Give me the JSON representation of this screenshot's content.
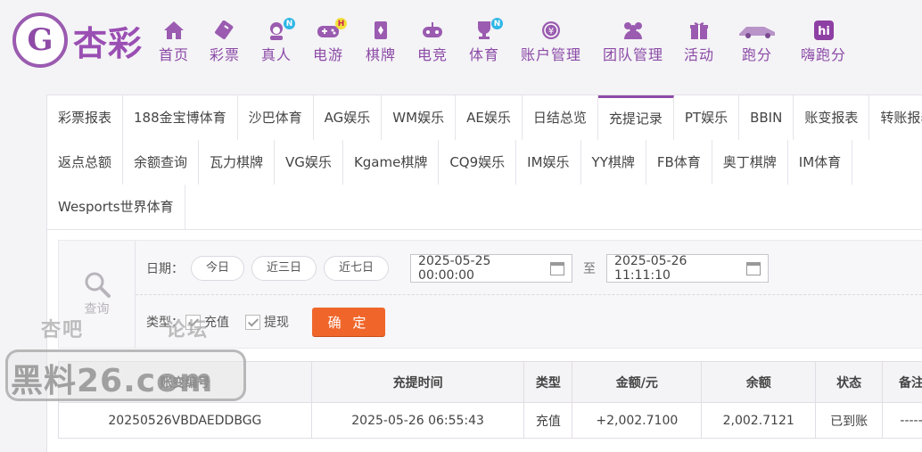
{
  "brand": {
    "logo_glyph": "G",
    "name": "杏彩"
  },
  "nav": [
    {
      "label": "首页",
      "icon": "home-icon"
    },
    {
      "label": "彩票",
      "icon": "lottery-ticket-icon"
    },
    {
      "label": "真人",
      "icon": "dealer-icon",
      "badge": "N"
    },
    {
      "label": "电游",
      "icon": "gamepad-icon",
      "badge": "H"
    },
    {
      "label": "棋牌",
      "icon": "cards-icon"
    },
    {
      "label": "电竞",
      "icon": "controller-icon"
    },
    {
      "label": "体育",
      "icon": "trophy-icon",
      "badge": "N"
    },
    {
      "label": "账户管理",
      "icon": "coin-icon"
    },
    {
      "label": "团队管理",
      "icon": "team-icon"
    },
    {
      "label": "活动",
      "icon": "gift-icon"
    },
    {
      "label": "跑分",
      "icon": "race-car-icon"
    },
    {
      "label": "嗨跑分",
      "icon": "hi-app-icon",
      "icon_text": "hi"
    }
  ],
  "tabs": {
    "row1": [
      "彩票报表",
      "188金宝博体育",
      "沙巴体育",
      "AG娱乐",
      "WM娱乐",
      "AE娱乐",
      "日结总览",
      "充提记录",
      "PT娱乐",
      "BBIN",
      "账变报表",
      "转账报表"
    ],
    "row2": [
      "返点总额",
      "余额查询",
      "瓦力棋牌",
      "VG娱乐",
      "Kgame棋牌",
      "CQ9娱乐",
      "IM娱乐",
      "YY棋牌",
      "FB体育",
      "奥丁棋牌",
      "IM体育"
    ],
    "row3": [
      "Wesports世界体育"
    ],
    "active": "充提记录"
  },
  "filter": {
    "query_label": "查询",
    "date_label": "日期：",
    "quick": [
      "今日",
      "近三日",
      "近七日"
    ],
    "start": "2025-05-25 00:00:00",
    "to": "至",
    "end": "2025-05-26 11:11:10",
    "type_label": "类型：",
    "types": [
      {
        "label": "充值",
        "checked": true
      },
      {
        "label": "提现",
        "checked": true
      }
    ],
    "confirm": "确 定"
  },
  "table": {
    "headers": [
      "账变编号",
      "充提时间",
      "类型",
      "金额/元",
      "余额",
      "状态",
      "备注"
    ],
    "rows": [
      {
        "id": "20250526VBDAEDDBGG",
        "time": "2025-05-26 06:55:43",
        "type": "充值",
        "amount": "+2,002.7100",
        "balance": "2,002.7121",
        "status": "已到账",
        "note": "-----"
      }
    ]
  },
  "watermark": {
    "line1a": "杏吧",
    "line1b": "论坛",
    "line2": "黑料26.com"
  },
  "colors": {
    "brand_purple": "#8b4aa6",
    "confirm_orange": "#f0662a",
    "amount_red": "#c0262b",
    "status_green": "#3aa135"
  }
}
